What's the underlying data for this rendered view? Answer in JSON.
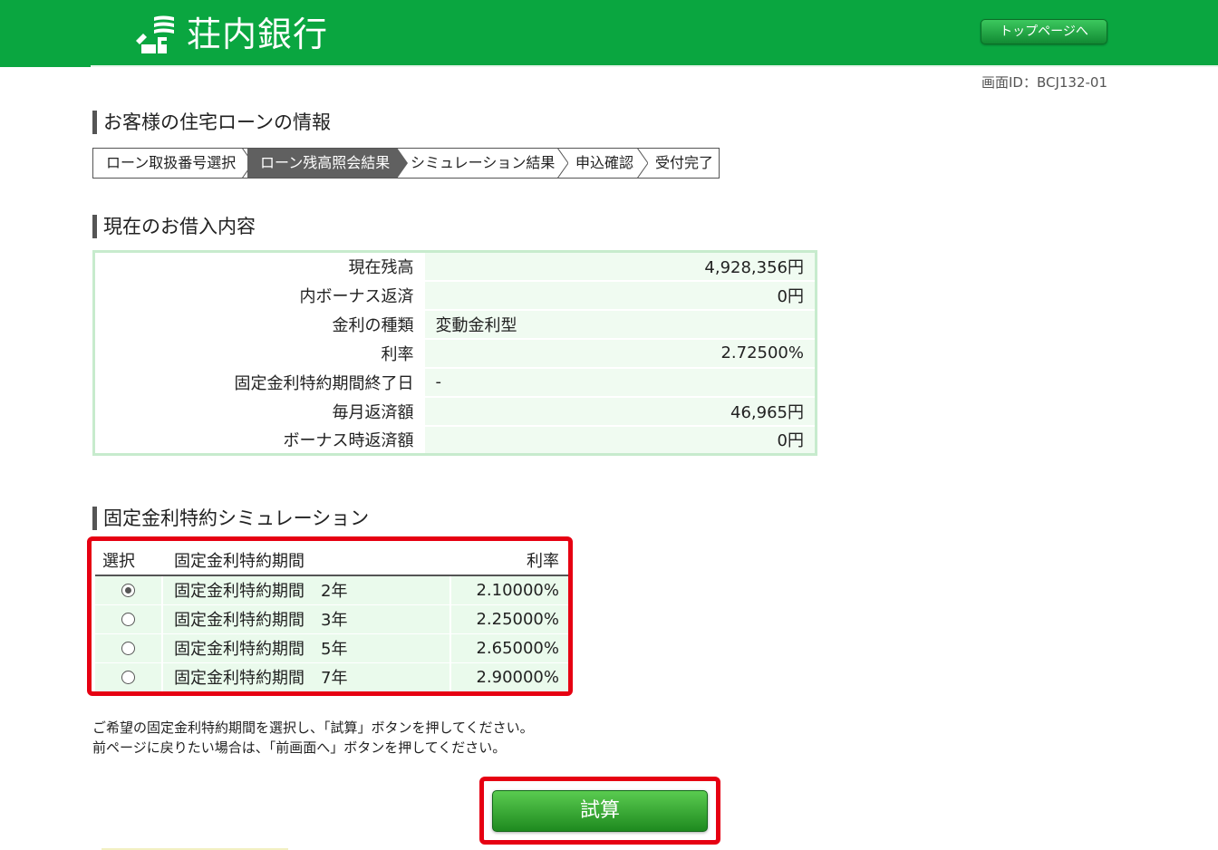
{
  "header": {
    "bank_name": "荘内銀行",
    "top_page_button": "トップページへ"
  },
  "screen_id": "画面ID：BCJ132-01",
  "page_title": "お客様の住宅ローンの情報",
  "steps": [
    "ローン取扱番号選択",
    "ローン残高照会結果",
    "シミュレーション結果",
    "申込確認",
    "受付完了"
  ],
  "current_loan": {
    "title": "現在のお借入内容",
    "rows": [
      {
        "label": "現在残高",
        "value": "4,928,356円"
      },
      {
        "label": "内ボーナス返済",
        "value": "0円"
      },
      {
        "label": "金利の種類",
        "value": "変動金利型"
      },
      {
        "label": "利率",
        "value": "2.72500%"
      },
      {
        "label": "固定金利特約期間終了日",
        "value": "-"
      },
      {
        "label": "毎月返済額",
        "value": "46,965円"
      },
      {
        "label": "ボーナス時返済額",
        "value": "0円"
      }
    ]
  },
  "simulation": {
    "title": "固定金利特約シミュレーション",
    "headers": {
      "select": "選択",
      "period": "固定金利特約期間",
      "rate": "利率"
    },
    "rows": [
      {
        "period": "固定金利特約期間　2年",
        "rate": "2.10000%",
        "selected": true
      },
      {
        "period": "固定金利特約期間　3年",
        "rate": "2.25000%",
        "selected": false
      },
      {
        "period": "固定金利特約期間　5年",
        "rate": "2.65000%",
        "selected": false
      },
      {
        "period": "固定金利特約期間　7年",
        "rate": "2.90000%",
        "selected": false
      }
    ]
  },
  "notes": [
    "ご希望の固定金利特約期間を選択し、「試算」ボタンを押してください。",
    "前ページに戻りたい場合は、「前画面へ」ボタンを押してください。"
  ],
  "calc_button": "試算",
  "colors": {
    "header_green": "#0aa640",
    "highlight_red": "#e60012",
    "table_border": "#c7ebcd",
    "active_step": "#606060"
  },
  "icons": {
    "logo": "shonai-bank-logo-icon",
    "step_separator": "chevron-right-icon",
    "radio": "radio-button-icon"
  }
}
